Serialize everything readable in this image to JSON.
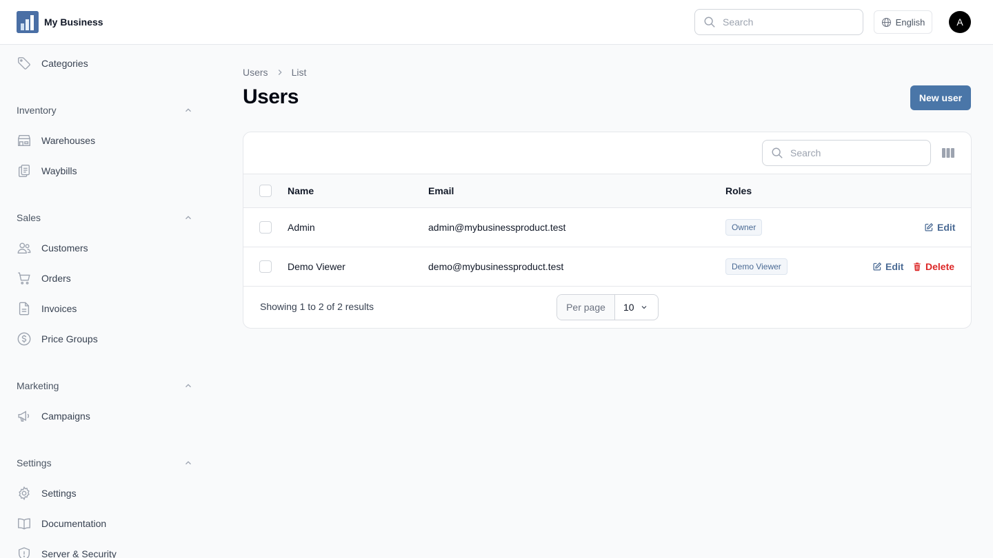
{
  "brand": {
    "name": "My Business"
  },
  "topbar": {
    "search_placeholder": "Search",
    "language": "English",
    "avatar_initial": "A"
  },
  "sidebar": {
    "items_top": [
      {
        "label": "Categories",
        "icon": "tag-icon"
      }
    ],
    "groups": [
      {
        "label": "Inventory",
        "items": [
          {
            "label": "Warehouses",
            "icon": "building-storefront-icon"
          },
          {
            "label": "Waybills",
            "icon": "clipboard-document-list-icon"
          }
        ]
      },
      {
        "label": "Sales",
        "items": [
          {
            "label": "Customers",
            "icon": "users-icon"
          },
          {
            "label": "Orders",
            "icon": "shopping-cart-icon"
          },
          {
            "label": "Invoices",
            "icon": "document-text-icon"
          },
          {
            "label": "Price Groups",
            "icon": "currency-dollar-icon"
          }
        ]
      },
      {
        "label": "Marketing",
        "items": [
          {
            "label": "Campaigns",
            "icon": "megaphone-icon"
          }
        ]
      },
      {
        "label": "Settings",
        "items": [
          {
            "label": "Settings",
            "icon": "cog-icon"
          },
          {
            "label": "Documentation",
            "icon": "book-open-icon"
          },
          {
            "label": "Server & Security",
            "icon": "shield-exclamation-icon"
          }
        ]
      }
    ]
  },
  "breadcrumb": [
    "Users",
    "List"
  ],
  "page": {
    "title": "Users",
    "new_button": "New user"
  },
  "table": {
    "search_placeholder": "Search",
    "columns": [
      "Name",
      "Email",
      "Roles"
    ],
    "rows": [
      {
        "name": "Admin",
        "email": "admin@mybusinessproduct.test",
        "role": "Owner",
        "actions": [
          "Edit"
        ]
      },
      {
        "name": "Demo Viewer",
        "email": "demo@mybusinessproduct.test",
        "role": "Demo Viewer",
        "actions": [
          "Edit",
          "Delete"
        ]
      }
    ],
    "footer": {
      "summary": "Showing 1 to 2 of 2 results",
      "per_page_label": "Per page",
      "per_page_value": "10"
    }
  },
  "colors": {
    "primary": "#4a76a8",
    "danger": "#dc2626",
    "badge_text": "#4a6a94"
  }
}
